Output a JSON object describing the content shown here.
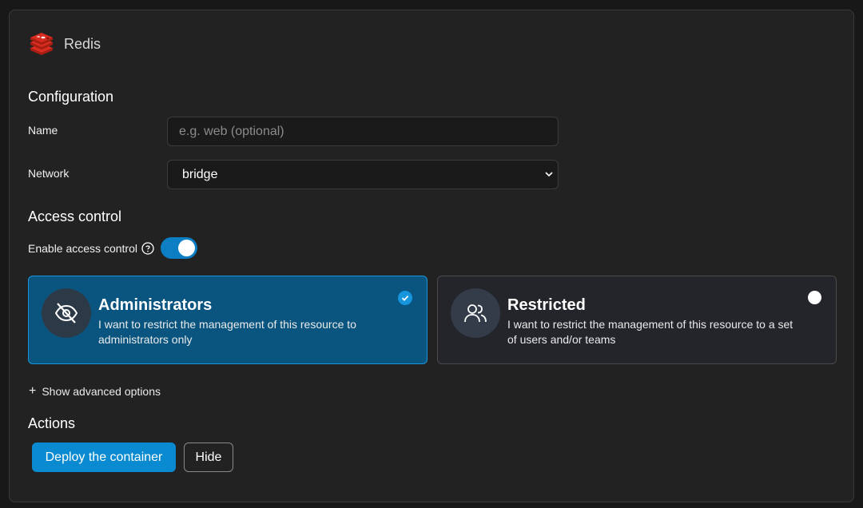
{
  "app": {
    "title": "Redis",
    "logo_icon": "redis-logo-icon"
  },
  "configuration": {
    "heading": "Configuration",
    "name": {
      "label": "Name",
      "placeholder": "e.g. web (optional)",
      "value": ""
    },
    "network": {
      "label": "Network",
      "selected": "bridge"
    }
  },
  "access_control": {
    "heading": "Access control",
    "toggle_label": "Enable access control",
    "enabled": true,
    "options": [
      {
        "title": "Administrators",
        "description": "I want to restrict the management of this resource to administrators only",
        "selected": true,
        "icon": "eye-slash-icon"
      },
      {
        "title": "Restricted",
        "description": "I want to restrict the management of this resource to a set of users and/or teams",
        "selected": false,
        "icon": "users-icon"
      }
    ]
  },
  "advanced": {
    "plus": "+",
    "label": "Show advanced options"
  },
  "actions": {
    "heading": "Actions",
    "deploy_label": "Deploy the container",
    "hide_label": "Hide"
  },
  "colors": {
    "accent": "#0a8ad0",
    "selected_card_bg": "#0a5580",
    "panel_bg": "#222222",
    "page_bg": "#181818"
  }
}
